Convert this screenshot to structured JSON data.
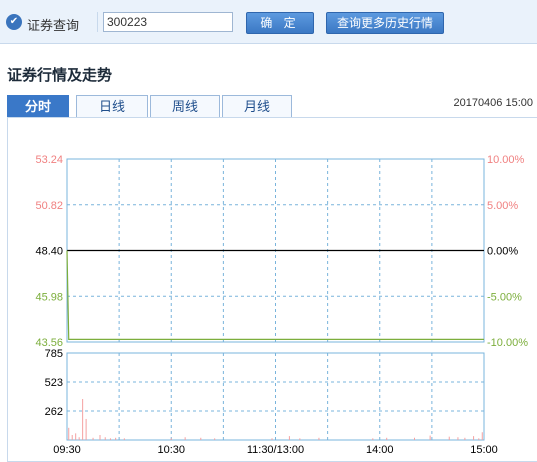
{
  "query_bar": {
    "label": "证券查询",
    "code_value": "300223",
    "confirm_label": "确 定",
    "history_label": "查询更多历史行情"
  },
  "section": {
    "title": "证券行情及走势"
  },
  "tabs": [
    {
      "label": "分时",
      "active": true
    },
    {
      "label": "日线",
      "active": false
    },
    {
      "label": "周线",
      "active": false
    },
    {
      "label": "月线",
      "active": false
    }
  ],
  "timestamp": "20170406  15:00",
  "colors": {
    "up": "#f08080",
    "down": "#7cae3c",
    "neutral": "#000000",
    "grid": "#79b4dc",
    "price_line": "#7cae3c",
    "volume_bar": "#f4a0a0"
  },
  "chart_data": {
    "type": "line",
    "title": "",
    "x_ticks": [
      "09:30",
      "10:30",
      "11:30/13:00",
      "14:00",
      "15:00"
    ],
    "price_axis": {
      "ticks": [
        53.24,
        50.82,
        48.4,
        45.98,
        43.56
      ],
      "tick_labels": [
        "53.24",
        "50.82",
        "48.40",
        "45.98",
        "43.56"
      ],
      "tick_colors": [
        "up",
        "up",
        "neutral",
        "down",
        "down"
      ],
      "range": [
        43.56,
        53.24
      ],
      "prev_close": 48.4
    },
    "percent_axis": {
      "tick_labels": [
        "10.00%",
        "5.00%",
        "0.00%",
        "-5.00%",
        "-10.00%"
      ],
      "tick_colors": [
        "up",
        "up",
        "neutral",
        "down",
        "down"
      ],
      "range": [
        -10,
        10
      ]
    },
    "price_series": {
      "minutes": [
        0,
        1,
        240
      ],
      "values": [
        48.4,
        43.7,
        43.7
      ]
    },
    "volume_axis": {
      "ticks": [
        785,
        523,
        262
      ],
      "tick_labels": [
        "785",
        "523",
        "262"
      ],
      "range": [
        0,
        785
      ]
    },
    "volume_series": {
      "minutes": [
        1,
        3,
        5,
        7,
        9,
        11,
        15,
        19,
        22,
        25,
        28,
        33,
        60,
        68,
        77,
        85,
        118,
        128,
        134,
        145,
        176,
        184,
        200,
        209,
        220,
        225,
        229,
        234,
        237,
        239
      ],
      "values": [
        110,
        45,
        60,
        25,
        370,
        190,
        20,
        45,
        25,
        15,
        20,
        15,
        15,
        25,
        20,
        15,
        15,
        35,
        15,
        20,
        15,
        20,
        20,
        40,
        30,
        25,
        20,
        35,
        15,
        70
      ]
    }
  }
}
